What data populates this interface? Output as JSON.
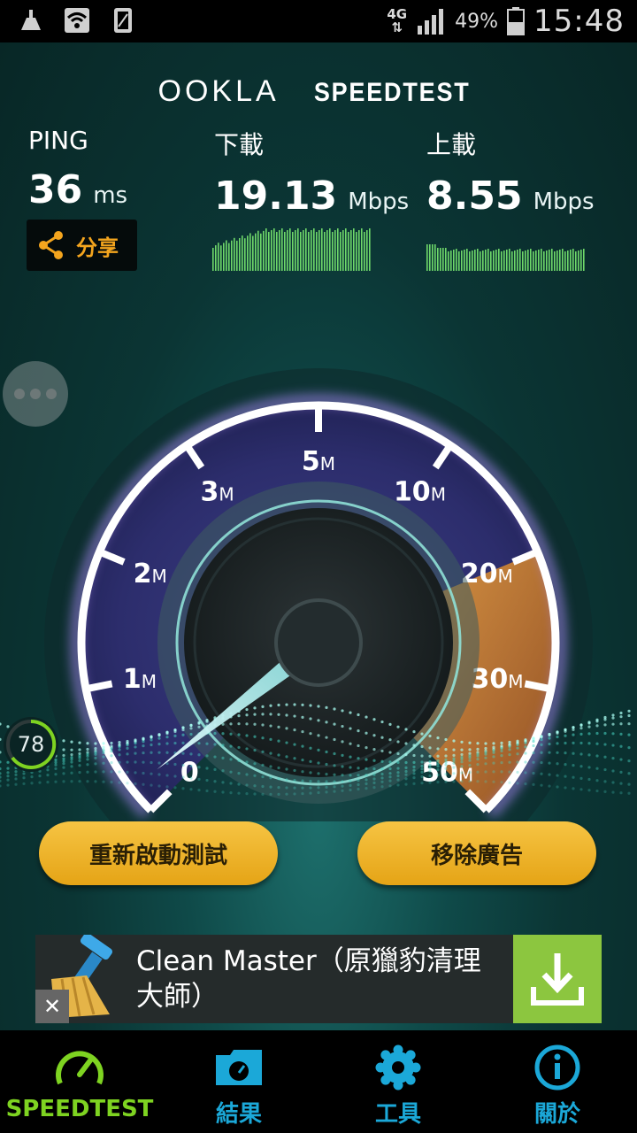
{
  "status_bar": {
    "network": "4G",
    "battery": "49%",
    "time": "15:48"
  },
  "header": {
    "brand": "OOKLA",
    "product": "SPEEDTEST"
  },
  "metrics": {
    "ping": {
      "label": "PING",
      "value": "36",
      "unit": "ms"
    },
    "download": {
      "label": "下載",
      "value": "19.13",
      "unit": "Mbps"
    },
    "upload": {
      "label": "上載",
      "value": "8.55",
      "unit": "Mbps"
    }
  },
  "share": {
    "label": "分享"
  },
  "gauge": {
    "ticks": [
      {
        "num": "0",
        "unit": ""
      },
      {
        "num": "1",
        "unit": "M"
      },
      {
        "num": "2",
        "unit": "M"
      },
      {
        "num": "3",
        "unit": "M"
      },
      {
        "num": "5",
        "unit": "M"
      },
      {
        "num": "10",
        "unit": "M"
      },
      {
        "num": "20",
        "unit": "M"
      },
      {
        "num": "30",
        "unit": "M"
      },
      {
        "num": "50",
        "unit": "M"
      }
    ],
    "needle_value": 0
  },
  "score": "78",
  "buttons": {
    "restart": "重新啟動測試",
    "remove_ads": "移除廣告"
  },
  "ad": {
    "line1": "Clean Master（原獵豹清理",
    "line2": "大師）",
    "close": "✕"
  },
  "nav": [
    {
      "label": "SPEEDTEST",
      "icon": "speedometer-icon",
      "active": true
    },
    {
      "label": "結果",
      "icon": "results-folder-icon",
      "active": false
    },
    {
      "label": "工具",
      "icon": "gear-icon",
      "active": false
    },
    {
      "label": "關於",
      "icon": "info-icon",
      "active": false
    }
  ],
  "colors": {
    "accent_orange": "#f4a51e",
    "nav_active": "#7ed321",
    "nav_inactive": "#1ba8d8",
    "button_gold": "#f0b52a"
  }
}
